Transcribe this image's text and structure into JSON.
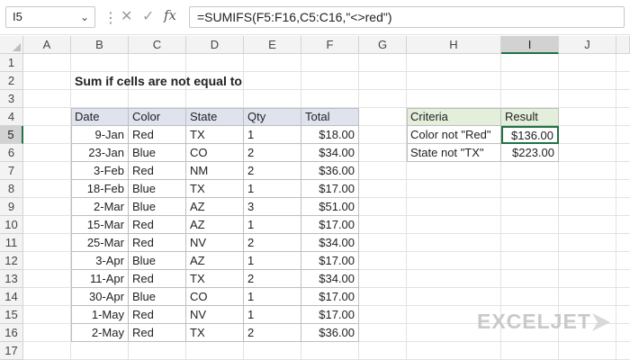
{
  "formula_bar": {
    "name_box": "I5",
    "formula": "=SUMIFS(F5:F16,C5:C16,\"<>red\")",
    "fx_label": "fx"
  },
  "columns": [
    "A",
    "B",
    "C",
    "D",
    "E",
    "F",
    "G",
    "H",
    "I",
    "J"
  ],
  "active_column": "I",
  "rows": [
    "1",
    "2",
    "3",
    "4",
    "5",
    "6",
    "7",
    "8",
    "9",
    "10",
    "11",
    "12",
    "13",
    "14",
    "15",
    "16",
    "17"
  ],
  "active_row": "5",
  "title": "Sum if cells are not equal to",
  "table": {
    "headers": [
      "Date",
      "Color",
      "State",
      "Qty",
      "Total"
    ],
    "rows": [
      [
        "9-Jan",
        "Red",
        "TX",
        "1",
        "$18.00"
      ],
      [
        "23-Jan",
        "Blue",
        "CO",
        "2",
        "$34.00"
      ],
      [
        "3-Feb",
        "Red",
        "NM",
        "2",
        "$36.00"
      ],
      [
        "18-Feb",
        "Blue",
        "TX",
        "1",
        "$17.00"
      ],
      [
        "2-Mar",
        "Blue",
        "AZ",
        "3",
        "$51.00"
      ],
      [
        "15-Mar",
        "Red",
        "AZ",
        "1",
        "$17.00"
      ],
      [
        "25-Mar",
        "Red",
        "NV",
        "2",
        "$34.00"
      ],
      [
        "3-Apr",
        "Blue",
        "AZ",
        "1",
        "$17.00"
      ],
      [
        "11-Apr",
        "Red",
        "TX",
        "2",
        "$34.00"
      ],
      [
        "30-Apr",
        "Blue",
        "CO",
        "1",
        "$17.00"
      ],
      [
        "1-May",
        "Red",
        "NV",
        "1",
        "$17.00"
      ],
      [
        "2-May",
        "Red",
        "TX",
        "2",
        "$36.00"
      ]
    ]
  },
  "criteria": {
    "headers": [
      "Criteria",
      "Result"
    ],
    "rows": [
      [
        "Color not \"Red\"",
        "$136.00"
      ],
      [
        "State not \"TX\"",
        "$223.00"
      ]
    ]
  },
  "brand": "EXCELJET",
  "colors": {
    "accent": "#217346",
    "table_header": "#dfe3ee",
    "criteria_header": "#e4efdb"
  }
}
